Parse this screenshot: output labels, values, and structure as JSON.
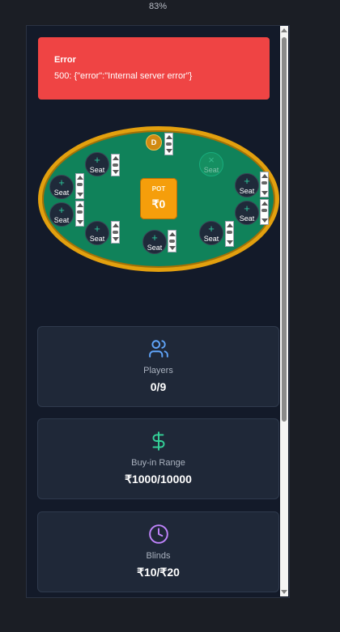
{
  "browser": {
    "zoom": "83%"
  },
  "error": {
    "title": "Error",
    "message": "500: {\"error\":\"Internal server error\"}"
  },
  "table": {
    "dealer_label": "D",
    "pot_label": "POT",
    "pot_value": "₹0",
    "seat_label": "Seat",
    "seat_plus": "+",
    "seat_closed": "×"
  },
  "stats": [
    {
      "icon": "users-icon",
      "label": "Players",
      "value": "0/9",
      "color": "#60a5fa"
    },
    {
      "icon": "dollar-icon",
      "label": "Buy-in Range",
      "value": "₹1000/10000",
      "color": "#34d399"
    },
    {
      "icon": "clock-icon",
      "label": "Blinds",
      "value": "₹10/₹20",
      "color": "#c084fc"
    }
  ],
  "colors": {
    "error_bg": "#ef4444",
    "felt": "#10825a",
    "rim": "#e3a00e",
    "pot": "#f59e0b",
    "panel": "#131a29"
  }
}
